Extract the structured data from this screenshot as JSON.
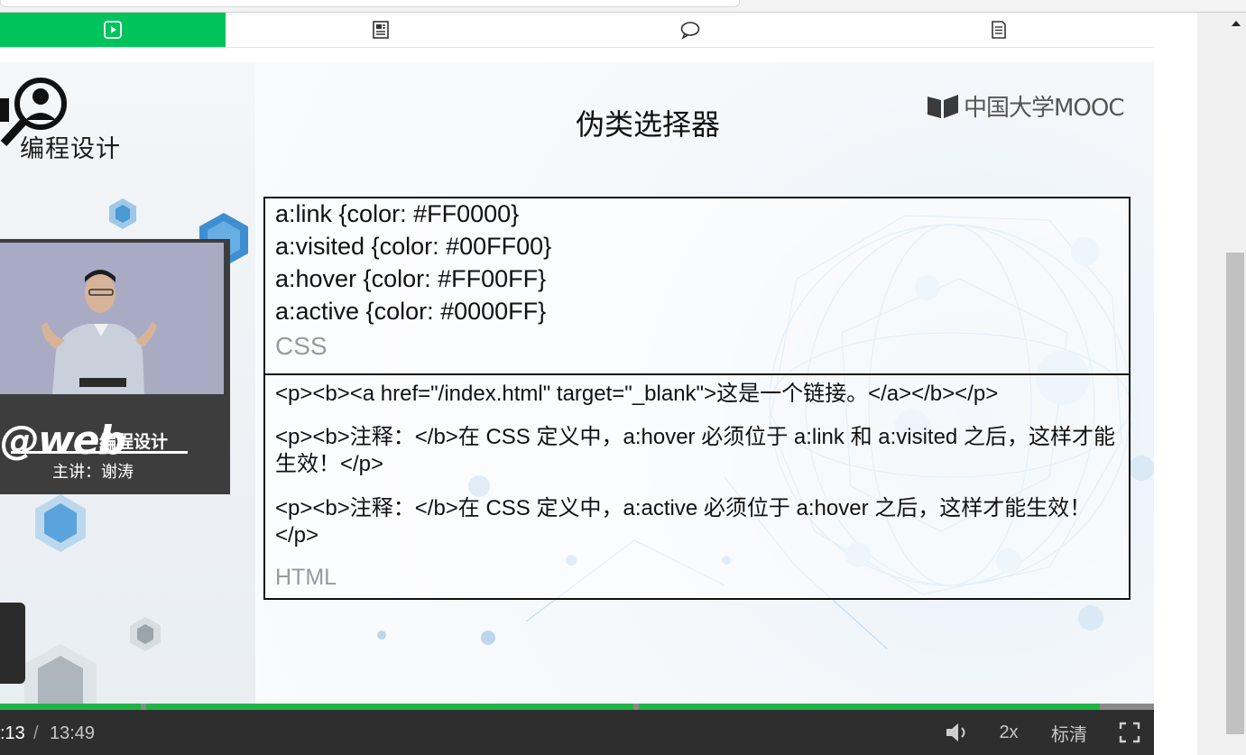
{
  "tabs": [
    {
      "icon": "play-icon",
      "active": true
    },
    {
      "icon": "notes-icon",
      "active": false
    },
    {
      "icon": "comment-icon",
      "active": false
    },
    {
      "icon": "document-icon",
      "active": false
    }
  ],
  "left_panel": {
    "logo_title": "编程设计",
    "brand_web": "@web",
    "brand_text": "编程设计",
    "teacher": "主讲：谢涛"
  },
  "slide": {
    "title": "伪类选择器",
    "logo_text": "中国大学MOOC",
    "css_lines": [
      "a:link {color: #FF0000}",
      "a:visited {color: #00FF00}",
      "a:hover {color: #FF00FF}",
      "a:active {color: #0000FF}"
    ],
    "css_label": "CSS",
    "html_lines": [
      "<p><b><a href=\"/index.html\" target=\"_blank\">这是一个链接。</a></b></p>",
      "<p><b>注释：</b>在 CSS 定义中，a:hover 必须位于 a:link 和 a:visited 之后，这样才能生效！</p>",
      "<p><b>注释：</b>在 CSS 定义中，a:active 必须位于 a:hover 之后，这样才能生效！</p>"
    ],
    "html_label": "HTML"
  },
  "player": {
    "current_time": ":13",
    "separator": "/",
    "total_time": "13:49",
    "speed": "2x",
    "quality": "标清",
    "colors": {
      "progress": "#21b347",
      "tab_active": "#00c35c",
      "control_bar": "#2e2e2e"
    }
  }
}
